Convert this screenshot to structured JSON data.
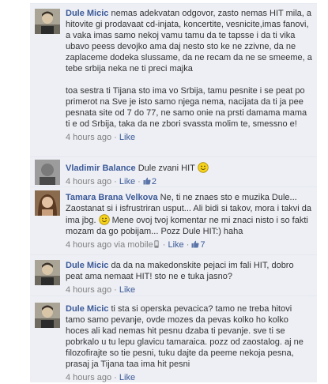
{
  "comments": [
    {
      "author": "Dule Micic",
      "text": "nemas adekvatan odgovor, zasto nemas HIT mila, a hitovite gi prodavaat cd-injata, koncertite, vesnicite,imas fanovi, a vaka imas samo nekoj vamu tamu da te tapsse i da ti vika ubavo peess devojko ama daj nesto sto ke ne zzivne, da ne zaplaceme dodeka slussame, da ne recam da ne se smeeme, a tebe srbija neka ne ti preci majka\n\ntoa sestra ti Tijana sto ima vo Srbija, tamu pesnite i se peat po primerot na Sve je isto samo njega nema, nacijata da ti ja pee pesnata site od 7 do 77, ne samo onie na prsti damama mama ti e od Srbija, taka da ne zbori svassta molim te, smessno e!",
      "time": "4 hours ago",
      "sep": "·",
      "like": "Like"
    },
    {
      "author": "Vladimir Balance",
      "text_before": "Dule zvani HIT ",
      "time": "4 hours ago",
      "sep": "·",
      "like": "Like",
      "likes_count": "2"
    },
    {
      "author": "Tamara Brana Velkova",
      "text_before": "Ne, ti ne znaes sto e muzika Dule... Zaostanat si i isfrustriran usput... Ali bidi si takov, mora i takvi da ima jbg. ",
      "text_after": " Mene ovoj tvoj komentar ne mi znaci nisto i so fakti mozam da go pobijam... Pozz Dule HIT:) haha",
      "time": "4 hours ago",
      "via": "via mobile",
      "sep": "·",
      "like": "Like",
      "likes_count": "7"
    },
    {
      "author": "Dule Micic",
      "text": "da da na makedonskite pejaci im fali HIT, dobro peat ama nemaat HIT! sto ne e tuka jasno?",
      "time": "4 hours ago",
      "sep": "·",
      "like": "Like"
    },
    {
      "author": "Dule Micic",
      "text": "ti sta si operska pevacica? tamo ne treba hitovi tamo samo pevanje, ovde mozes da pevas kolko ho kolko hoces ali kad nemas hit pesnu dzaba ti pevanje. sve ti se pobrkalo u tu lepu glavicu tamaraica. pozz od zaostalog. aj ne filozofirajte so tie pesni, tuku dajte da peeme nekoja pesna, prasaj ja Tijana taa ima hit pesni",
      "time": "4 hours ago",
      "sep": "·",
      "like": "Like"
    }
  ],
  "colors": {
    "link": "#3b5998",
    "comment_bg": "#edeff4",
    "meta": "#808080",
    "smiley": "#f5d21c"
  }
}
